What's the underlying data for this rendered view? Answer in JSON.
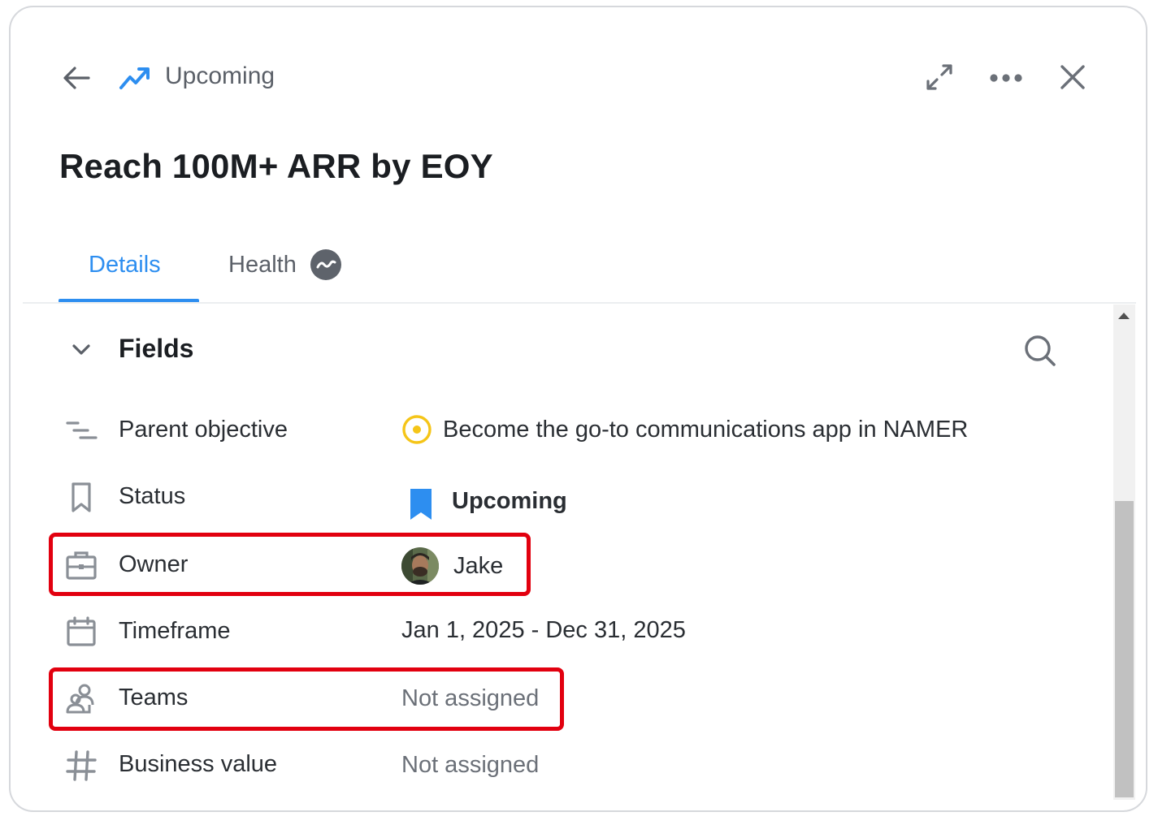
{
  "header": {
    "breadcrumb": "Upcoming",
    "icons": [
      "arrow-left-icon",
      "trending-up-icon",
      "expand-icon",
      "more-horizontal-icon",
      "close-icon"
    ]
  },
  "title": "Reach 100M+ ARR by EOY",
  "tabs": [
    {
      "label": "Details",
      "active": true
    },
    {
      "label": "Health",
      "active": false,
      "icon": "health-trend-icon"
    }
  ],
  "section": {
    "title": "Fields",
    "icons": [
      "chevron-down-icon",
      "search-icon"
    ]
  },
  "fields": {
    "parent_objective": {
      "label": "Parent objective",
      "value": "Become the go-to communications app in NAMER",
      "icon": "hierarchy-icon",
      "value_icon": "objective-circle-icon"
    },
    "status": {
      "label": "Status",
      "value": "Upcoming",
      "icon": "bookmark-icon",
      "value_icon": "bookmark-filled-icon"
    },
    "owner": {
      "label": "Owner",
      "value": "Jake",
      "icon": "briefcase-icon",
      "value_icon": "avatar"
    },
    "timeframe": {
      "label": "Timeframe",
      "value": "Jan 1, 2025 - Dec 31, 2025",
      "icon": "calendar-icon"
    },
    "teams": {
      "label": "Teams",
      "value": "Not assigned",
      "icon": "teams-icon"
    },
    "business_value": {
      "label": "Business value",
      "value": "Not assigned",
      "icon": "hash-icon"
    }
  },
  "colors": {
    "accent": "#2d8ef0",
    "objective_ring": "#f5c518",
    "highlight": "#e2000f"
  }
}
